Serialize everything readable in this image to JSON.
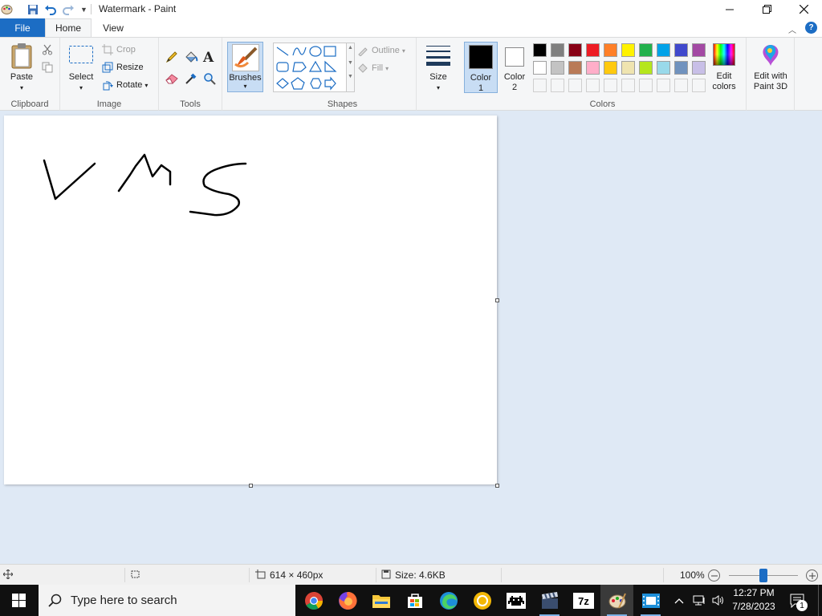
{
  "window": {
    "title": "Watermark - Paint"
  },
  "tabs": {
    "file": "File",
    "home": "Home",
    "view": "View"
  },
  "ribbon": {
    "clipboard": {
      "label": "Clipboard",
      "paste": "Paste"
    },
    "image": {
      "label": "Image",
      "select": "Select",
      "crop": "Crop",
      "resize": "Resize",
      "rotate": "Rotate"
    },
    "tools": {
      "label": "Tools"
    },
    "brushes": "Brushes",
    "shapes": {
      "label": "Shapes",
      "outline": "Outline",
      "fill": "Fill"
    },
    "size": "Size",
    "color1": {
      "line1": "Color",
      "line2": "1"
    },
    "color2": {
      "line1": "Color",
      "line2": "2"
    },
    "colors": {
      "label": "Colors",
      "row1": [
        "#000000",
        "#7f7f7f",
        "#880015",
        "#ed1c24",
        "#ff7f27",
        "#fff200",
        "#22b14c",
        "#00a2e8",
        "#3f48cc",
        "#a349a4"
      ],
      "row2": [
        "#ffffff",
        "#c3c3c3",
        "#b97a57",
        "#ffaec9",
        "#ffc90e",
        "#efe4b0",
        "#b5e61d",
        "#99d9ea",
        "#7092be",
        "#c8bfe7"
      ]
    },
    "edit_colors": {
      "line1": "Edit",
      "line2": "colors"
    },
    "paint3d": {
      "line1": "Edit with",
      "line2": "Paint 3D"
    }
  },
  "canvas": {
    "drawing": "V M S (handwritten)"
  },
  "status": {
    "dimensions": "614 × 460px",
    "size": "Size: 4.6KB",
    "zoom": "100%"
  },
  "taskbar": {
    "search_placeholder": "Type here to search",
    "time": "12:27 PM",
    "date": "7/28/2023",
    "notifications": "1"
  }
}
